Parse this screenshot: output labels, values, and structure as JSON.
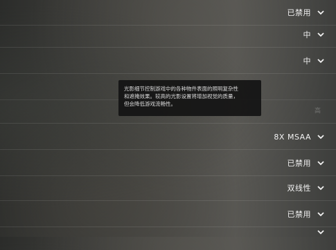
{
  "settings": [
    {
      "value": "已禁用"
    },
    {
      "value": "中"
    },
    {
      "value": "中"
    },
    {
      "value": ""
    },
    {
      "value": "8X MSAA"
    },
    {
      "value": "已禁用"
    },
    {
      "value": "双线性"
    },
    {
      "value": "已禁用"
    },
    {
      "value": ""
    }
  ],
  "tooltip": {
    "line1": "光影细节控制游戏中的各种物件表面的照明复杂性",
    "line2": "和遮掩效果。较高的光影设置将增加视觉的质量，",
    "line3": "但会降低游戏流畅性。"
  },
  "ghost_value": "高"
}
